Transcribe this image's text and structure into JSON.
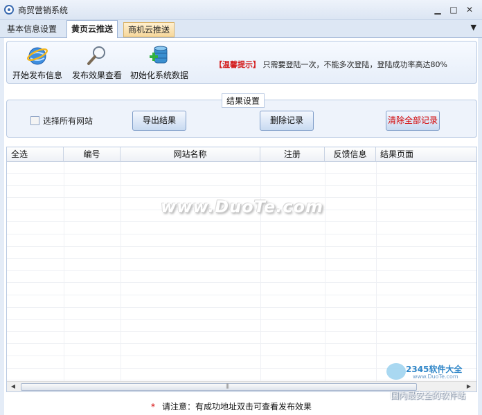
{
  "window": {
    "title": "商贸营销系统",
    "minimize_glyph": "▁",
    "maximize_glyph": "□",
    "close_glyph": "✕"
  },
  "tabs": [
    {
      "label": "基本信息设置",
      "active": false
    },
    {
      "label": "黄页云推送",
      "active": true
    },
    {
      "label": "商机云推送",
      "active": false
    }
  ],
  "tab_menu_glyph": "▼",
  "toolbar": {
    "items": [
      {
        "label": "开始发布信息",
        "icon": "browser-globe-icon"
      },
      {
        "label": "发布效果查看",
        "icon": "magnifier-icon"
      },
      {
        "label": "初始化系统数据",
        "icon": "database-add-icon"
      }
    ],
    "notice_tag": "【温馨提示】",
    "notice_text": "只需要登陆一次，不能多次登陆，登陆成功率高达80%"
  },
  "result_settings": {
    "legend": "结果设置",
    "select_all_label": "选择所有网站",
    "select_all_checked": false,
    "export_button": "导出结果",
    "delete_button": "删除记录",
    "clear_all_button": "清除全部记录"
  },
  "table": {
    "columns": [
      "全选",
      "编号",
      "网站名称",
      "注册",
      "反馈信息",
      "结果页面"
    ],
    "rows": []
  },
  "watermark": "www.DuoTe.com",
  "footnote": {
    "star": "*",
    "text": "请注意：有成功地址双击可查看发布效果"
  },
  "corner_logo": {
    "brand": "2345软件大全",
    "url": "www.DuoTe.com",
    "slogan": "国内最安全的软件站"
  },
  "colors": {
    "accent": "#3a6ab0",
    "warning": "#d42020",
    "panel_border": "#b8c9e2"
  }
}
